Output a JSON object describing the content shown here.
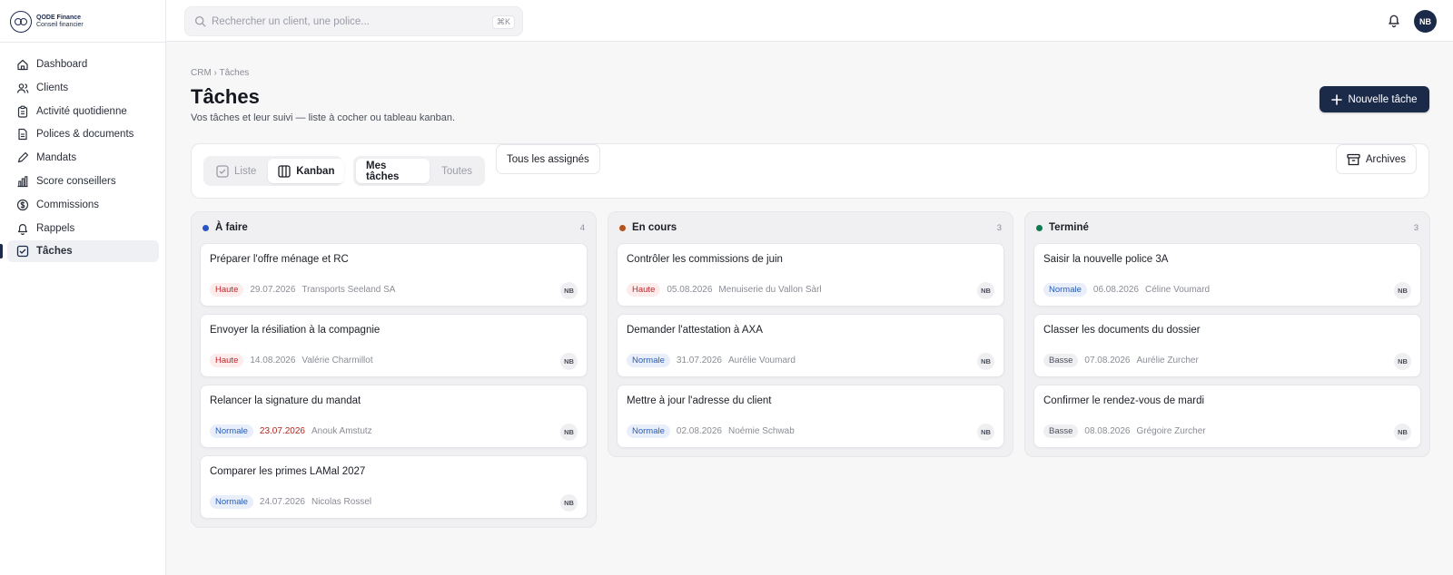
{
  "brand": {
    "line1": "QODE Finance",
    "line2": "Conseil financier"
  },
  "nav": [
    {
      "label": "Dashboard",
      "icon": "home-icon",
      "active": false
    },
    {
      "label": "Clients",
      "icon": "users-icon",
      "active": false
    },
    {
      "label": "Activité quotidienne",
      "icon": "clipboard-icon",
      "active": false
    },
    {
      "label": "Polices & documents",
      "icon": "document-icon",
      "active": false
    },
    {
      "label": "Mandats",
      "icon": "pen-icon",
      "active": false
    },
    {
      "label": "Score conseillers",
      "icon": "bar-chart-icon",
      "active": false
    },
    {
      "label": "Commissions",
      "icon": "dollar-icon",
      "active": false
    },
    {
      "label": "Rappels",
      "icon": "bell-icon",
      "active": false
    },
    {
      "label": "Tâches",
      "icon": "checkbox-icon",
      "active": true
    }
  ],
  "search": {
    "placeholder": "Rechercher un client, une police...",
    "shortcut": "⌘K"
  },
  "user": {
    "initials": "NB"
  },
  "breadcrumb": "CRM › Tâches",
  "page": {
    "title": "Tâches",
    "subtitle": "Vos tâches et leur suivi — liste à cocher ou tableau kanban."
  },
  "actions": {
    "new_task": "Nouvelle tâche",
    "archives": "Archives"
  },
  "view_toggle": {
    "list": "Liste",
    "kanban": "Kanban",
    "selected": "Kanban"
  },
  "scope_toggle": {
    "mine": "Mes tâches",
    "all": "Toutes",
    "selected": "Mes tâches"
  },
  "assignee_filter": "Tous les assignés",
  "columns": [
    {
      "title": "À faire",
      "count": "4",
      "color": "#2c55c4",
      "cards": [
        {
          "title": "Préparer l'offre ménage et RC",
          "priority": "Haute",
          "date": "29.07.2026",
          "overdue": false,
          "client": "Transports Seeland SA",
          "assignee": "NB"
        },
        {
          "title": "Envoyer la résiliation à la compagnie",
          "priority": "Haute",
          "date": "14.08.2026",
          "overdue": false,
          "client": "Valérie Charmillot",
          "assignee": "NB"
        },
        {
          "title": "Relancer la signature du mandat",
          "priority": "Normale",
          "date": "23.07.2026",
          "overdue": true,
          "client": "Anouk Amstutz",
          "assignee": "NB"
        },
        {
          "title": "Comparer les primes LAMal 2027",
          "priority": "Normale",
          "date": "24.07.2026",
          "overdue": false,
          "client": "Nicolas Rossel",
          "assignee": "NB"
        }
      ]
    },
    {
      "title": "En cours",
      "count": "3",
      "color": "#b5541a",
      "cards": [
        {
          "title": "Contrôler les commissions de juin",
          "priority": "Haute",
          "date": "05.08.2026",
          "overdue": false,
          "client": "Menuiserie du Vallon Sàrl",
          "assignee": "NB"
        },
        {
          "title": "Demander l'attestation à AXA",
          "priority": "Normale",
          "date": "31.07.2026",
          "overdue": false,
          "client": "Aurélie Voumard",
          "assignee": "NB"
        },
        {
          "title": "Mettre à jour l'adresse du client",
          "priority": "Normale",
          "date": "02.08.2026",
          "overdue": false,
          "client": "Noémie Schwab",
          "assignee": "NB"
        }
      ]
    },
    {
      "title": "Terminé",
      "count": "3",
      "color": "#0e7a4f",
      "cards": [
        {
          "title": "Saisir la nouvelle police 3A",
          "priority": "Normale",
          "date": "06.08.2026",
          "overdue": false,
          "client": "Céline Voumard",
          "assignee": "NB"
        },
        {
          "title": "Classer les documents du dossier",
          "priority": "Basse",
          "date": "07.08.2026",
          "overdue": false,
          "client": "Aurélie Zurcher",
          "assignee": "NB"
        },
        {
          "title": "Confirmer le rendez-vous de mardi",
          "priority": "Basse",
          "date": "08.08.2026",
          "overdue": false,
          "client": "Grégoire Zurcher",
          "assignee": "NB"
        }
      ]
    }
  ]
}
